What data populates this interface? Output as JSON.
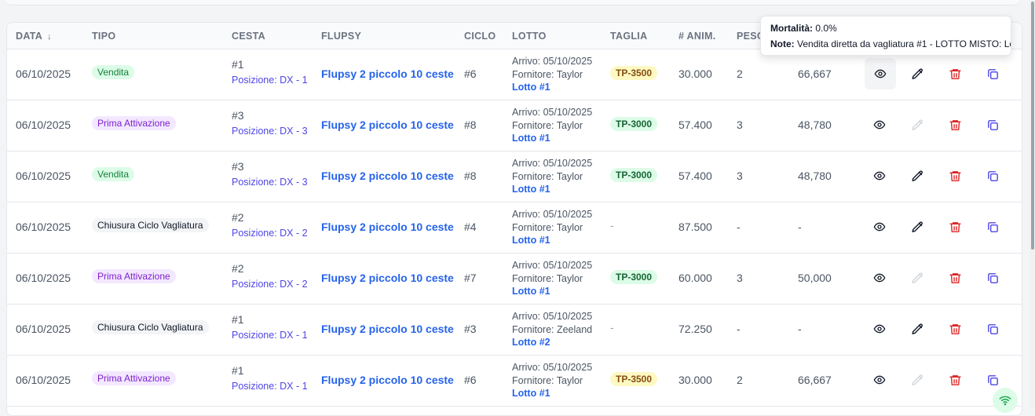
{
  "columns": [
    "DATA",
    "TIPO",
    "CESTA",
    "FLUPSY",
    "CICLO",
    "LOTTO",
    "TAGLIA",
    "# ANIM.",
    "PESO"
  ],
  "tooltip": {
    "mortality_label": "Mortalità:",
    "mortality_value": "0.0%",
    "note_label": "Note:",
    "note_value": "Vendita diretta da vagliatura #1 - LOTTO MISTO: Lo"
  },
  "rows": [
    {
      "date": "06/10/2025",
      "tipo": "Vendita",
      "tipo_style": "green",
      "cesta": "#1",
      "pos": "Posizione: DX - 1",
      "flupsy": "Flupsy 2 piccolo 10 ceste",
      "ciclo": "#6",
      "arrivo": "Arrivo: 05/10/2025",
      "fornitore": "Fornitore: Taylor",
      "lotto": "Lotto #1",
      "taglia": "TP-3500",
      "taglia_style": "yellow",
      "anim": "30.000",
      "peso": "2",
      "val": "66,667",
      "edit_enabled": true
    },
    {
      "date": "06/10/2025",
      "tipo": "Prima Attivazione",
      "tipo_style": "purple",
      "cesta": "#3",
      "pos": "Posizione: DX - 3",
      "flupsy": "Flupsy 2 piccolo 10 ceste",
      "ciclo": "#8",
      "arrivo": "Arrivo: 05/10/2025",
      "fornitore": "Fornitore: Taylor",
      "lotto": "Lotto #1",
      "taglia": "TP-3000",
      "taglia_style": "green",
      "anim": "57.400",
      "peso": "3",
      "val": "48,780",
      "edit_enabled": false
    },
    {
      "date": "06/10/2025",
      "tipo": "Vendita",
      "tipo_style": "green",
      "cesta": "#3",
      "pos": "Posizione: DX - 3",
      "flupsy": "Flupsy 2 piccolo 10 ceste",
      "ciclo": "#8",
      "arrivo": "Arrivo: 05/10/2025",
      "fornitore": "Fornitore: Taylor",
      "lotto": "Lotto #1",
      "taglia": "TP-3000",
      "taglia_style": "green",
      "anim": "57.400",
      "peso": "3",
      "val": "48,780",
      "edit_enabled": true
    },
    {
      "date": "06/10/2025",
      "tipo": "Chiusura Ciclo Vagliatura",
      "tipo_style": "gray",
      "cesta": "#2",
      "pos": "Posizione: DX - 2",
      "flupsy": "Flupsy 2 piccolo 10 ceste",
      "ciclo": "#4",
      "arrivo": "Arrivo: 05/10/2025",
      "fornitore": "Fornitore: Taylor",
      "lotto": "Lotto #1",
      "taglia": "-",
      "taglia_style": "none",
      "anim": "87.500",
      "peso": "-",
      "val": "-",
      "edit_enabled": true
    },
    {
      "date": "06/10/2025",
      "tipo": "Prima Attivazione",
      "tipo_style": "purple",
      "cesta": "#2",
      "pos": "Posizione: DX - 2",
      "flupsy": "Flupsy 2 piccolo 10 ceste",
      "ciclo": "#7",
      "arrivo": "Arrivo: 05/10/2025",
      "fornitore": "Fornitore: Taylor",
      "lotto": "Lotto #1",
      "taglia": "TP-3000",
      "taglia_style": "green",
      "anim": "60.000",
      "peso": "3",
      "val": "50,000",
      "edit_enabled": false
    },
    {
      "date": "06/10/2025",
      "tipo": "Chiusura Ciclo Vagliatura",
      "tipo_style": "gray",
      "cesta": "#1",
      "pos": "Posizione: DX - 1",
      "flupsy": "Flupsy 2 piccolo 10 ceste",
      "ciclo": "#3",
      "arrivo": "Arrivo: 05/10/2025",
      "fornitore": "Fornitore: Zeeland",
      "lotto": "Lotto #2",
      "taglia": "-",
      "taglia_style": "none",
      "anim": "72.250",
      "peso": "-",
      "val": "-",
      "edit_enabled": true
    },
    {
      "date": "06/10/2025",
      "tipo": "Prima Attivazione",
      "tipo_style": "purple",
      "cesta": "#1",
      "pos": "Posizione: DX - 1",
      "flupsy": "Flupsy 2 piccolo 10 ceste",
      "ciclo": "#6",
      "arrivo": "Arrivo: 05/10/2025",
      "fornitore": "Fornitore: Taylor",
      "lotto": "Lotto #1",
      "taglia": "TP-3500",
      "taglia_style": "yellow",
      "anim": "30.000",
      "peso": "2",
      "val": "66,667",
      "edit_enabled": false
    }
  ],
  "icons": {
    "view": "eye-icon",
    "edit": "pencil-icon",
    "delete": "trash-icon",
    "copy": "copy-icon",
    "status": "wifi-icon"
  },
  "colors": {
    "link": "#2563eb",
    "delete": "#dc2626",
    "copy": "#4f46e5",
    "edit_disabled": "#d1d5db"
  }
}
